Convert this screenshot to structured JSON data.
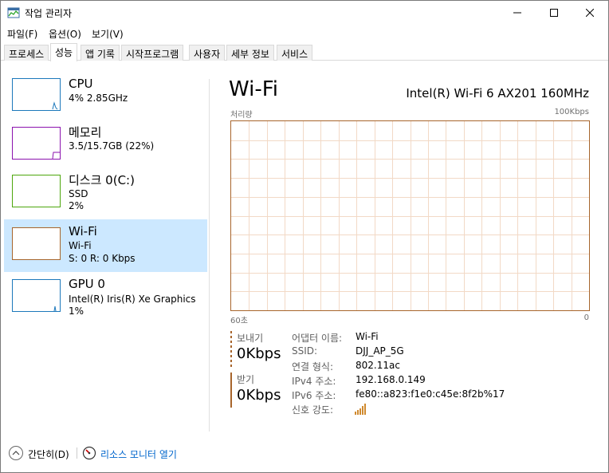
{
  "window": {
    "title": "작업 관리자"
  },
  "menu": [
    "파일(F)",
    "옵션(O)",
    "보기(V)"
  ],
  "tabs": [
    "프로세스",
    "성능",
    "앱 기록",
    "시작프로그램",
    "사용자",
    "세부 정보",
    "서비스"
  ],
  "sidebar": {
    "items": [
      {
        "title": "CPU",
        "line1": "4% 2.85GHz",
        "line2": "",
        "line3": "",
        "color": "#1c78bb"
      },
      {
        "title": "메모리",
        "line1": "3.5/15.7GB (22%)",
        "line2": "",
        "line3": "",
        "color": "#8b12ae"
      },
      {
        "title": "디스크 0(C:)",
        "line1": "SSD",
        "line2": "2%",
        "line3": "",
        "color": "#4da60c"
      },
      {
        "title": "Wi-Fi",
        "line1": "Wi-Fi",
        "line2": "S: 0 R: 0 Kbps",
        "line3": "",
        "color": "#a7652c"
      },
      {
        "title": "GPU 0",
        "line1": "Intel(R) Iris(R) Xe Graphics",
        "line2": "1%",
        "line3": "",
        "color": "#1c78bb"
      }
    ]
  },
  "main": {
    "title": "Wi-Fi",
    "adapter": "Intel(R) Wi-Fi 6 AX201 160MHz",
    "graph": {
      "label_left": "처리량",
      "label_right": "100Kbps",
      "foot_left": "60초",
      "foot_right": "0"
    },
    "send": {
      "label": "보내기",
      "value": "0Kbps"
    },
    "receive": {
      "label": "받기",
      "value": "0Kbps"
    },
    "details": [
      {
        "key": "어댑터 이름:",
        "value": "Wi-Fi"
      },
      {
        "key": "SSID:",
        "value": "DJJ_AP_5G"
      },
      {
        "key": "연결 형식:",
        "value": "802.11ac"
      },
      {
        "key": "IPv4 주소:",
        "value": "192.168.0.149"
      },
      {
        "key": "IPv6 주소:",
        "value": "fe80::a823:f1e0:c45e:8f2b%17"
      },
      {
        "key": "신호 강도:",
        "value": ""
      }
    ]
  },
  "footer": {
    "collapse_label": "간단히(D)",
    "resmon_label": "리소스 모니터 열기"
  },
  "colors": {
    "accent_wifi": "#a7652c",
    "selected_bg": "#cce8ff",
    "link": "#0066cc"
  }
}
